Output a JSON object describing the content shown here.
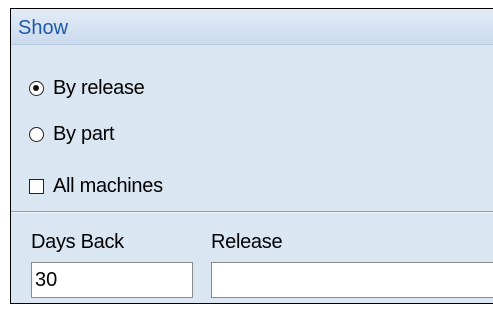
{
  "panel": {
    "title": "Show"
  },
  "options": {
    "by_release": {
      "label": "By release",
      "selected": true
    },
    "by_part": {
      "label": "By part",
      "selected": false
    },
    "all_machines": {
      "label": "All machines",
      "checked": false
    }
  },
  "fields": {
    "days_back": {
      "label": "Days Back",
      "value": "30"
    },
    "release": {
      "label": "Release",
      "value": ""
    }
  },
  "colors": {
    "panel_background": "#dbe6f3",
    "title_text": "#1f5aa6"
  }
}
